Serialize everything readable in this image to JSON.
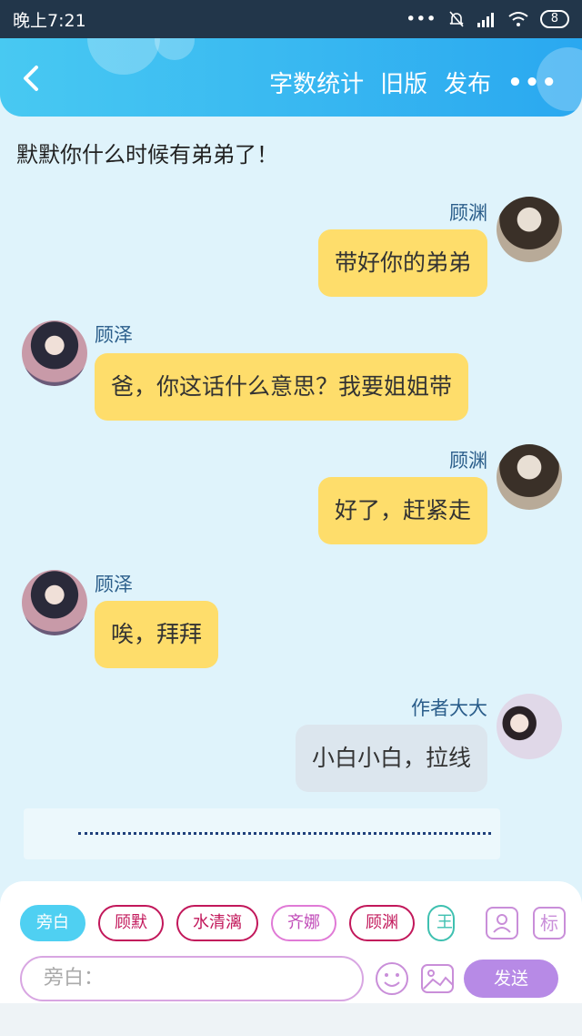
{
  "status": {
    "time": "晚上7:21",
    "signal_dots": "•••",
    "battery": "8"
  },
  "header": {
    "word_count": "字数统计",
    "old_version": "旧版",
    "publish": "发布",
    "more": "•••"
  },
  "narration_top": "默默你什么时候有弟弟了！",
  "messages": [
    {
      "side": "right",
      "name": "顾渊",
      "text": "带好你的弟弟"
    },
    {
      "side": "left",
      "name": "顾泽",
      "text": "爸，你这话什么意思？我要姐姐带"
    },
    {
      "side": "right",
      "name": "顾渊",
      "text": "好了，赶紧走"
    },
    {
      "side": "left",
      "name": "顾泽",
      "text": "唉，拜拜"
    },
    {
      "side": "right",
      "name": "作者大大",
      "text": "小白小白，拉线"
    }
  ],
  "divider_text": ".........................................................",
  "chips": [
    "旁白",
    "顾默",
    "水清漓",
    "齐娜",
    "顾渊",
    "王"
  ],
  "icon_buttons": {
    "character": "👤",
    "mark": "标"
  },
  "input_placeholder": "旁白：",
  "send_label": "发送",
  "colors": {
    "bubble": "#fedd6b",
    "author_bubble": "#dce6ee",
    "header": "#2aa8f0",
    "send": "#b78ae6"
  }
}
